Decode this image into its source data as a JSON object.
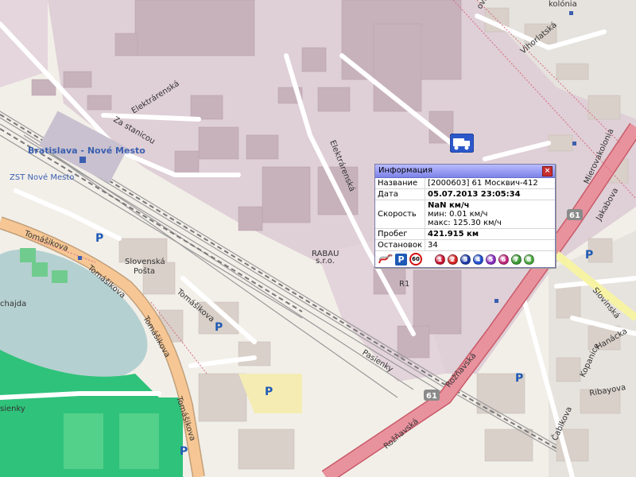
{
  "map": {
    "labels": {
      "station": "Bratislava - Nové Mesto",
      "zst": "ZST Nové Mesto",
      "tomasikova": "Tomášikova",
      "za_stanicou": "Za stanicou",
      "elektrarenska": "Elektrárenská",
      "slovenska_posta_1": "Slovenská",
      "slovenska_posta_2": "Pošta",
      "rabau_1": "RABAU",
      "rabau_2": "s.r.o.",
      "r1": "R1",
      "pasienky": "Pasienky",
      "roznavska": "Rožňavská",
      "kolonia": "kolónia",
      "vihorlatska": "Vihorlatská",
      "mierovakolonia": "Mierovakolonia",
      "jakabova": "Jakabova",
      "slovinska": "Slovinská",
      "hanacka": "Hanácka",
      "kopanice": "Kopanice",
      "ribayova": "Ribayova",
      "cablkova": "Čablkova",
      "chajda": "chajda",
      "sienky": "sienky",
      "ovce": "ová",
      "parking": "P",
      "route": "61"
    }
  },
  "popup": {
    "title": "Информация",
    "close": "×",
    "rows": [
      {
        "key": "Название",
        "value": "[2000603] 61 Москвич-412"
      },
      {
        "key": "Дата",
        "value": "05.07.2013 23:05:34"
      },
      {
        "key": "Скорость",
        "value": "NaN км/ч",
        "min": "мин: 0.01 км/ч",
        "max": "макс: 125.30 км/ч"
      },
      {
        "key": "Пробег",
        "value": "421.915 км"
      },
      {
        "key": "Остановок",
        "value": "34"
      }
    ],
    "icons": {
      "parking": "P",
      "speed": "60",
      "balls": [
        {
          "label": "1",
          "color": "#c8102e"
        },
        {
          "label": "2",
          "color": "#d42020"
        },
        {
          "label": "3",
          "color": "#1c3aa8"
        },
        {
          "label": "4",
          "color": "#1f4fd0"
        },
        {
          "label": "5",
          "color": "#8a2cc0"
        },
        {
          "label": "6",
          "color": "#c0257a"
        },
        {
          "label": "7",
          "color": "#3a9a32"
        },
        {
          "label": "8",
          "color": "#4aa83c"
        }
      ]
    }
  }
}
